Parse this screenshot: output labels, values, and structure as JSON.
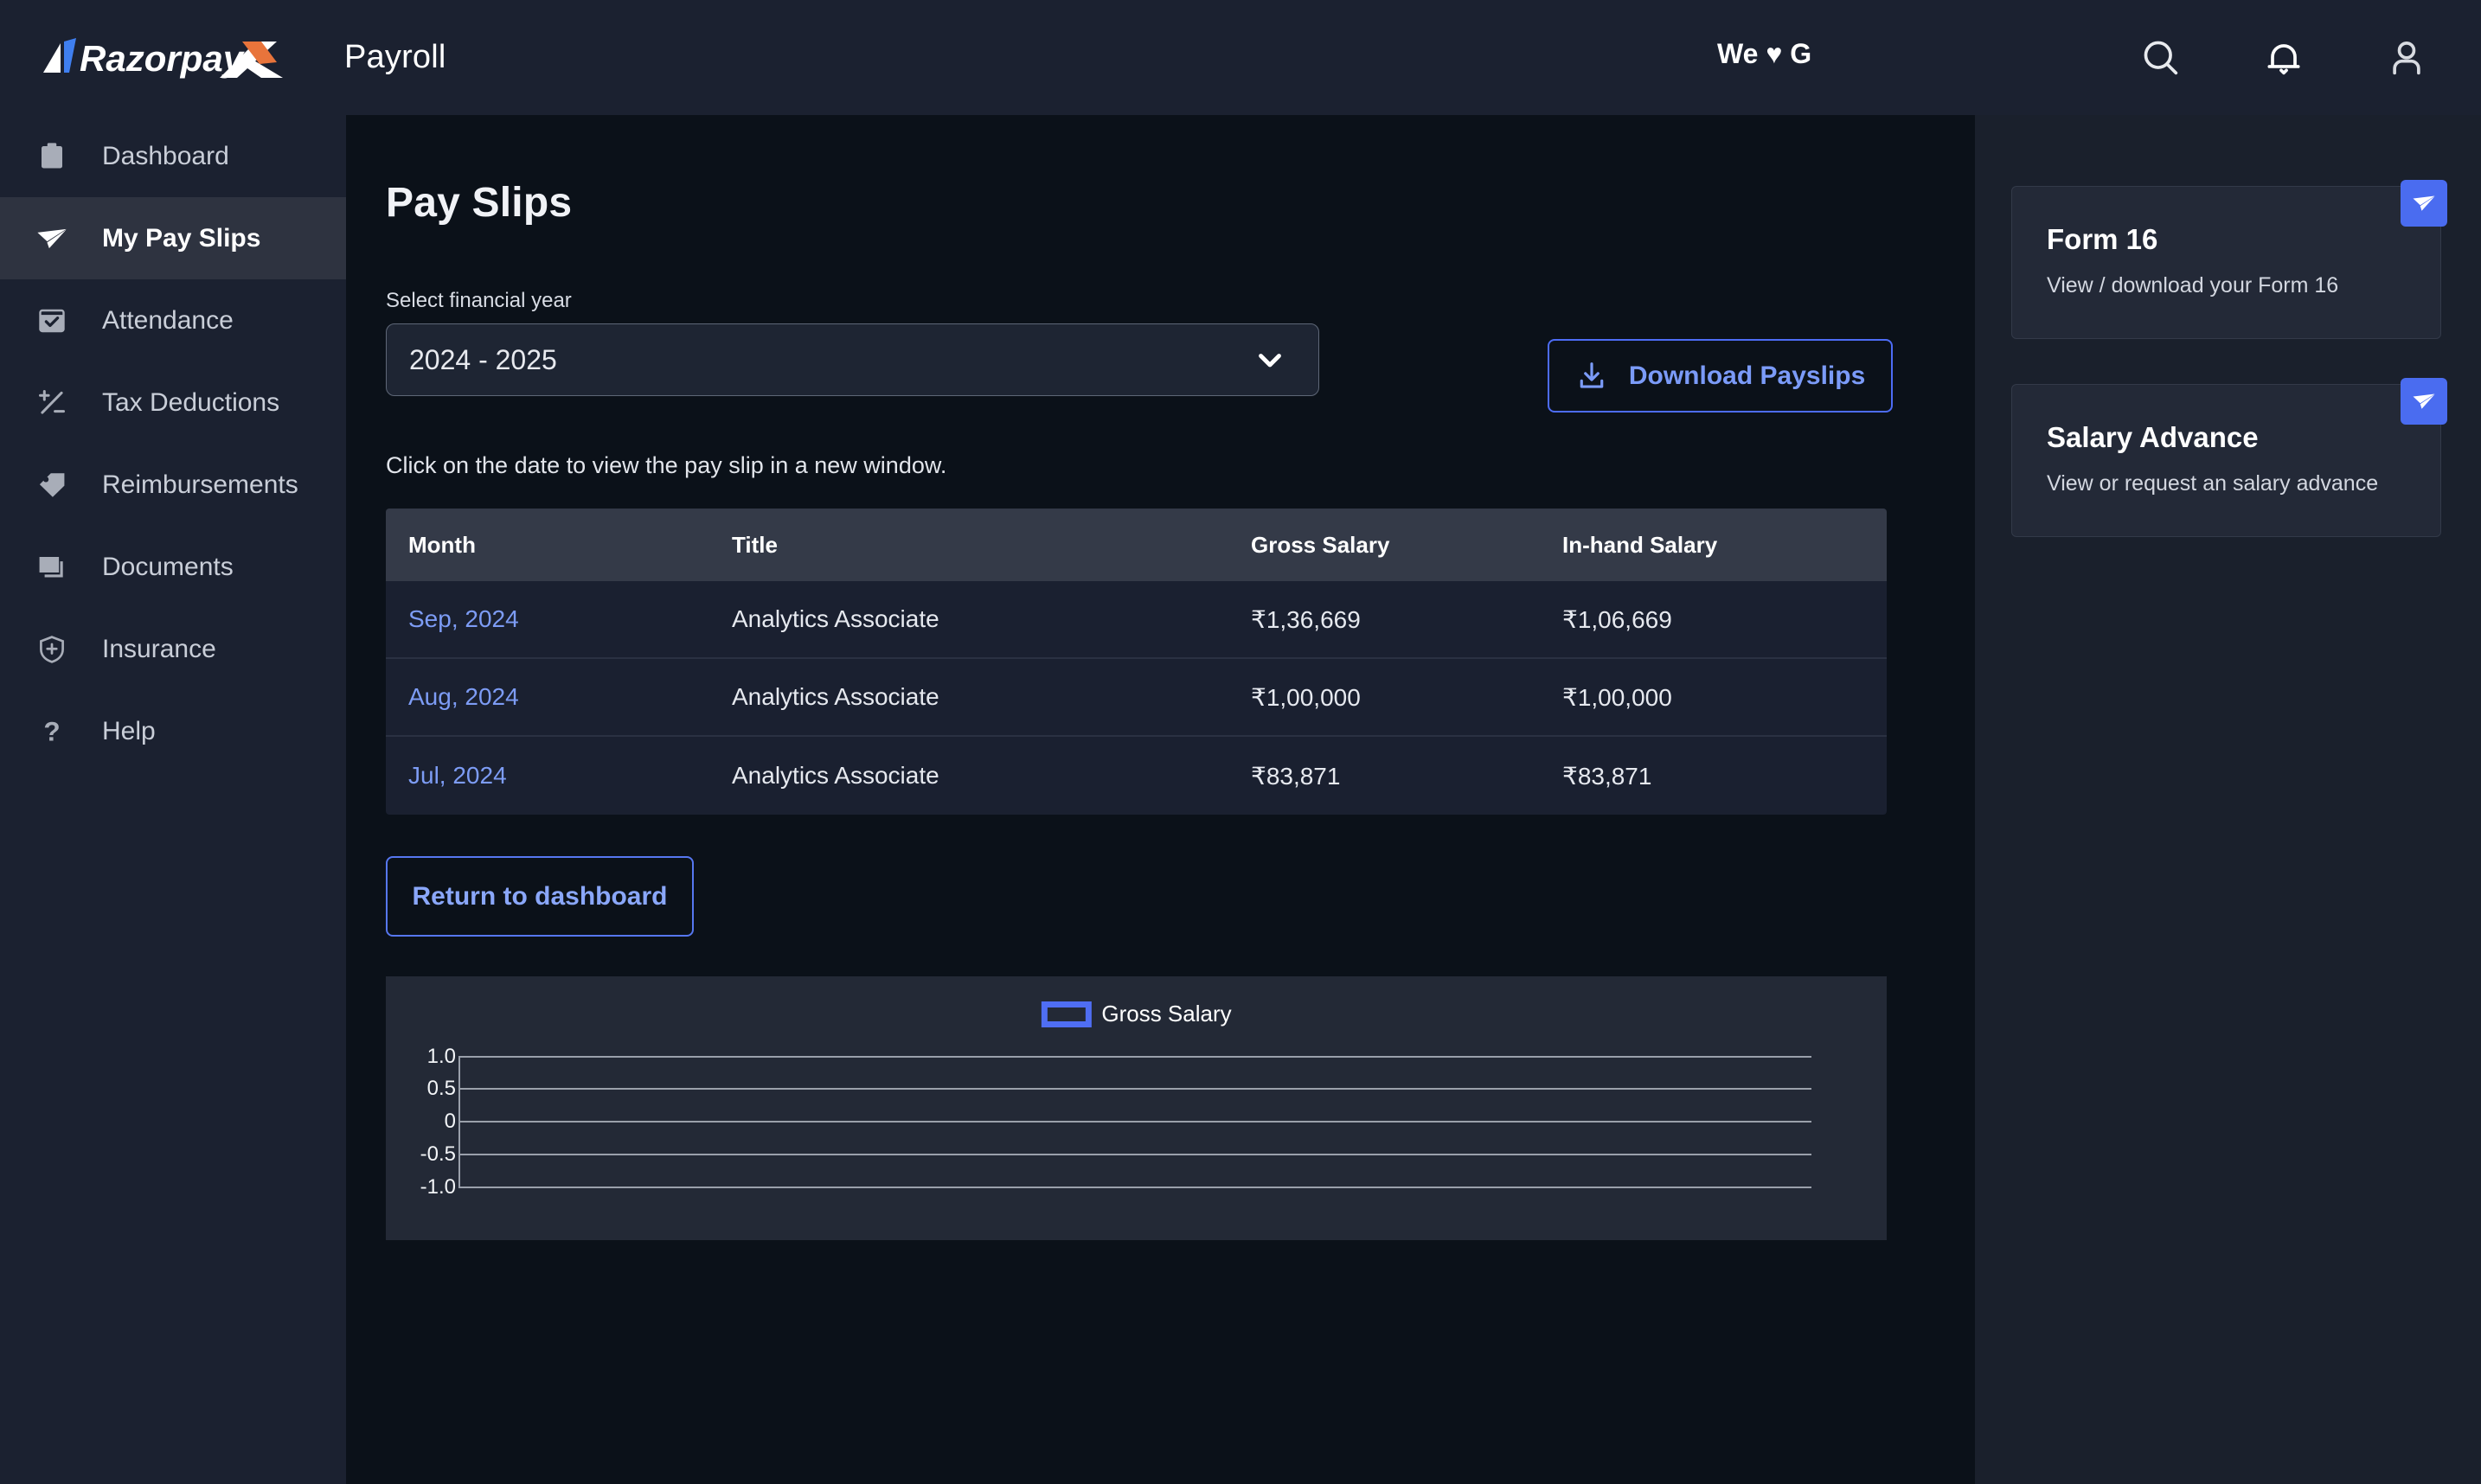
{
  "header": {
    "brand_name": "RazorpayX",
    "brand_suffix": "Payroll",
    "center_text": "We ♥ G",
    "icons": {
      "search": "search-icon",
      "notifications": "bell-icon",
      "profile": "user-icon"
    }
  },
  "sidebar": {
    "items": [
      {
        "label": "Dashboard",
        "icon": "clipboard-icon",
        "active": false
      },
      {
        "label": "My Pay Slips",
        "icon": "paper-plane-icon",
        "active": true
      },
      {
        "label": "Attendance",
        "icon": "calendar-check-icon",
        "active": false
      },
      {
        "label": "Tax Deductions",
        "icon": "plus-minus-icon",
        "active": false
      },
      {
        "label": "Reimbursements",
        "icon": "tag-icon",
        "active": false
      },
      {
        "label": "Documents",
        "icon": "documents-icon",
        "active": false
      },
      {
        "label": "Insurance",
        "icon": "shield-plus-icon",
        "active": false
      },
      {
        "label": "Help",
        "icon": "question-mark-icon",
        "active": false
      }
    ]
  },
  "main": {
    "page_title": "Pay Slips",
    "financial_year_label": "Select financial year",
    "financial_year_value": "2024 - 2025",
    "download_button": "Download Payslips",
    "hint": "Click on the date to view the pay slip in a new window.",
    "return_button": "Return to dashboard",
    "table": {
      "columns": [
        "Month",
        "Title",
        "Gross Salary",
        "In-hand Salary"
      ],
      "rows": [
        {
          "month": "Sep, 2024",
          "title": "Analytics Associate",
          "gross": "₹1,36,669",
          "inhand": "₹1,06,669"
        },
        {
          "month": "Aug, 2024",
          "title": "Analytics Associate",
          "gross": "₹1,00,000",
          "inhand": "₹1,00,000"
        },
        {
          "month": "Jul, 2024",
          "title": "Analytics Associate",
          "gross": "₹83,871",
          "inhand": "₹83,871"
        }
      ]
    }
  },
  "chart_data": {
    "type": "bar",
    "title": "",
    "xlabel": "",
    "ylabel": "",
    "categories": [],
    "series": [
      {
        "name": "Gross Salary",
        "values": []
      }
    ],
    "legend": [
      "Gross Salary"
    ],
    "legend_position": "top-center",
    "legend_color": "#4f6ef3",
    "ytick_labels": [
      "1.0",
      "0.5",
      "0",
      "-0.5",
      "-1.0"
    ],
    "ylim": [
      -1.0,
      1.0
    ],
    "grid": true,
    "empty": true
  },
  "rail": {
    "cards": [
      {
        "title": "Form 16",
        "subtitle": "View / download your Form 16",
        "badge_icon": "paper-plane-icon"
      },
      {
        "title": "Salary Advance",
        "subtitle": "View or request an salary advance",
        "badge_icon": "paper-plane-icon"
      }
    ]
  },
  "colors": {
    "accent_blue": "#4d6cf5",
    "link_blue": "#7d9cf5",
    "logo_blue": "#3f7ff0",
    "logo_orange": "#e8743b",
    "page_bg": "#1a202c",
    "main_bg": "#0b1119",
    "sidebar_bg": "#1b2130"
  }
}
